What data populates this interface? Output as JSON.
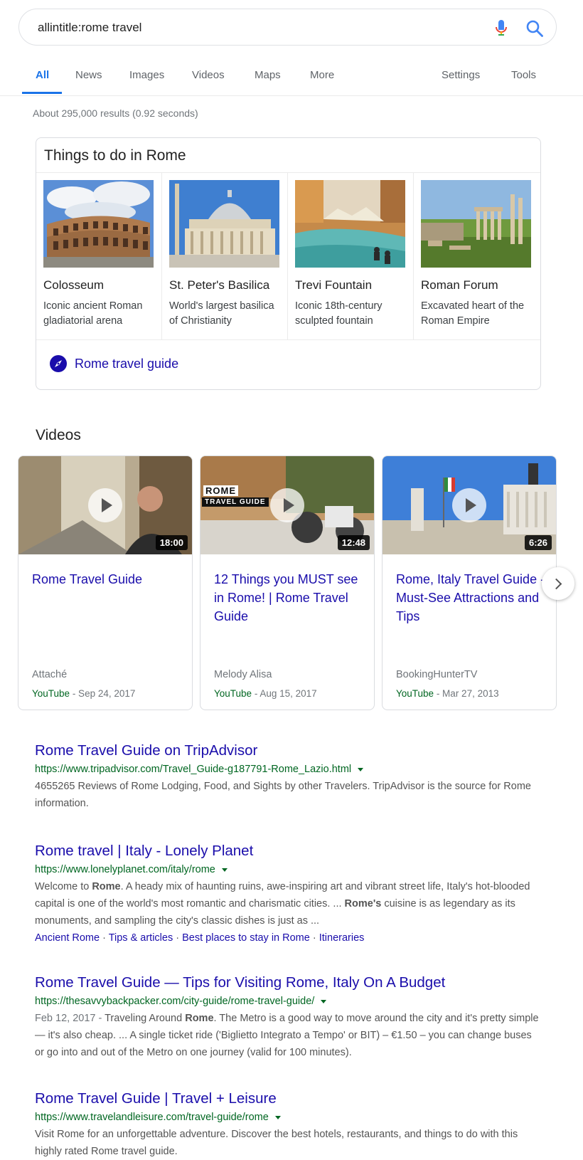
{
  "search": {
    "query": "allintitle:rome travel"
  },
  "tabs": {
    "all": "All",
    "news": "News",
    "images": "Images",
    "videos": "Videos",
    "maps": "Maps",
    "more": "More",
    "settings": "Settings",
    "tools": "Tools"
  },
  "stats": "About 295,000 results (0.92 seconds)",
  "things_to_do": {
    "title": "Things to do in Rome",
    "items": [
      {
        "name": "Colosseum",
        "desc": "Iconic ancient Roman gladiatorial arena"
      },
      {
        "name": "St. Peter's Basilica",
        "desc": "World's largest basilica of Christianity"
      },
      {
        "name": "Trevi Fountain",
        "desc": "Iconic 18th-century sculpted fountain"
      },
      {
        "name": "Roman Forum",
        "desc": "Excavated heart of the Roman Empire"
      }
    ],
    "guide_link": "Rome travel guide"
  },
  "videos": {
    "title": "Videos",
    "items": [
      {
        "title": "Rome Travel Guide",
        "duration": "18:00",
        "author": "Attaché",
        "source": "YouTube",
        "date": " - Sep 24, 2017"
      },
      {
        "title": "12 Things you MUST see in Rome! | Rome Travel Guide",
        "duration": "12:48",
        "author": "Melody Alisa",
        "source": "YouTube",
        "date": " - Aug 15, 2017",
        "thumb_text_1": "ROME",
        "thumb_text_2": "TRAVEL GUIDE"
      },
      {
        "title": "Rome, Italy Travel Guide - Must-See Attractions and Tips",
        "duration": "6:26",
        "author": "BookingHunterTV",
        "source": "YouTube",
        "date": " - Mar 27, 2013"
      }
    ]
  },
  "results": [
    {
      "title": "Rome Travel Guide on TripAdvisor",
      "url": "https://www.tripadvisor.com/Travel_Guide-g187791-Rome_Lazio.html",
      "snippet": "4655265 Reviews of Rome Lodging, Food, and Sights by other Travelers. TripAdvisor is the source for Rome information."
    },
    {
      "title": "Rome travel | Italy - Lonely Planet",
      "url": "https://www.lonelyplanet.com/italy/rome",
      "snippet_parts": {
        "p1": "Welcome to ",
        "b1": "Rome",
        "p2": ". A heady mix of haunting ruins, awe-inspiring art and vibrant street life, Italy's hot-blooded capital is one of the world's most romantic and charismatic cities. ... ",
        "b2": "Rome's",
        "p3": " cuisine is as legendary as its monuments, and sampling the city's classic dishes is just as ..."
      },
      "sitelinks": [
        "Ancient Rome",
        "Tips & articles",
        "Best places to stay in Rome",
        "Itineraries"
      ],
      "sitelink_sep": " · "
    },
    {
      "title": "Rome Travel Guide — Tips for Visiting Rome, Italy On A Budget",
      "url": "https://thesavvybackpacker.com/city-guide/rome-travel-guide/",
      "snippet_parts": {
        "date": "Feb 12, 2017 - ",
        "p1": "Traveling Around ",
        "b1": "Rome",
        "p2": ". The Metro is a good way to move around the city and it's pretty simple — it's also cheap. ... A single ticket ride ('Biglietto Integrato a Tempo' or BIT) – €1.50 – you can change buses or go into and out of the Metro on one journey (valid for 100 minutes)."
      }
    },
    {
      "title": "Rome Travel Guide | Travel + Leisure",
      "url": "https://www.travelandleisure.com/travel-guide/rome",
      "snippet": "Visit Rome for an unforgettable adventure. Discover the best hotels, restaurants, and things to do with this highly rated Rome travel guide."
    }
  ],
  "colors": {
    "link": "#1a0dab",
    "url": "#006621",
    "accent": "#1a73e8"
  }
}
